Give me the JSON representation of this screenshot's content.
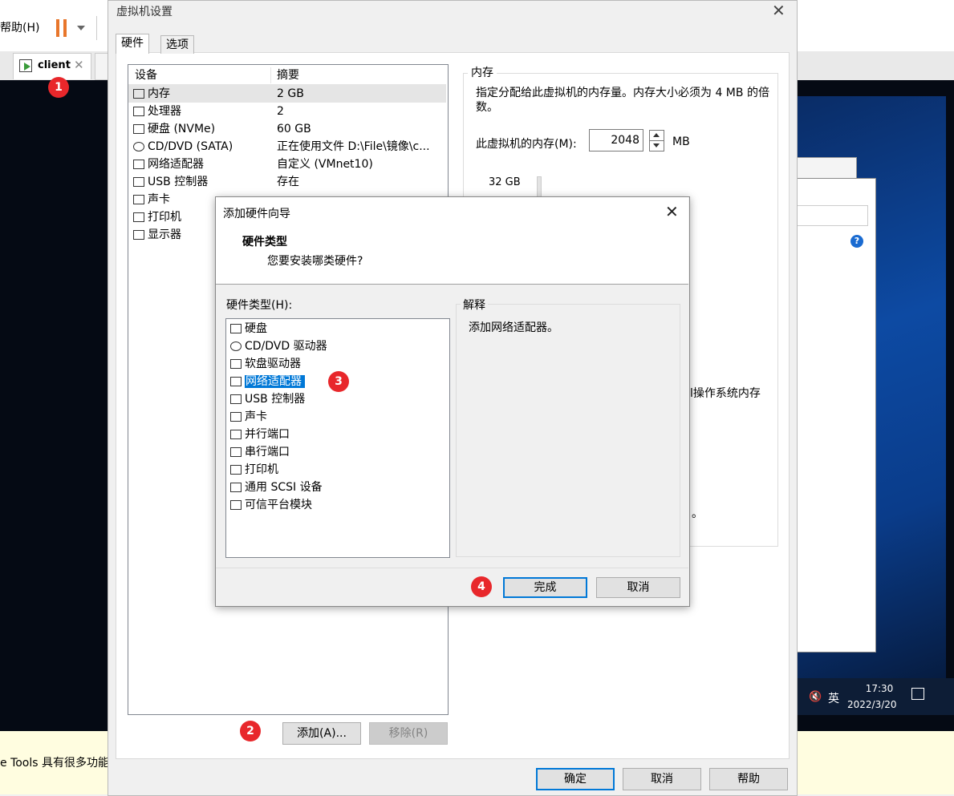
{
  "host": {
    "menu_help": "帮助(H)",
    "tab_label": "client",
    "tab_close": "✕",
    "bottom_text": "e Tools 具有很多功能"
  },
  "guest_tray": {
    "time": "17:30",
    "date": "2022/3/20",
    "lang": "英",
    "help_glyph": "?"
  },
  "settings": {
    "title": "虚拟机设置",
    "close": "✕",
    "tabs": [
      "硬件",
      "选项"
    ],
    "devices": {
      "header_device": "设备",
      "header_summary": "摘要",
      "rows": [
        {
          "name": "内存",
          "summary": "2 GB",
          "icon": "memory-icon"
        },
        {
          "name": "处理器",
          "summary": "2",
          "icon": "cpu-icon"
        },
        {
          "name": "硬盘 (NVMe)",
          "summary": "60 GB",
          "icon": "harddisk-icon"
        },
        {
          "name": "CD/DVD (SATA)",
          "summary": "正在使用文件 D:\\File\\镜像\\c...",
          "icon": "cd-icon"
        },
        {
          "name": "网络适配器",
          "summary": "自定义 (VMnet10)",
          "icon": "network-icon"
        },
        {
          "name": "USB 控制器",
          "summary": "存在",
          "icon": "usb-icon"
        },
        {
          "name": "声卡",
          "summary": "",
          "icon": "sound-icon"
        },
        {
          "name": "打印机",
          "summary": "",
          "icon": "printer-icon"
        },
        {
          "name": "显示器",
          "summary": "",
          "icon": "monitor-icon"
        }
      ]
    },
    "add_button": "添加(A)...",
    "remove_button": "移除(R)",
    "memory": {
      "group_label": "内存",
      "description": "指定分配给此虚拟机的内存量。内存大小必须为 4 MB 的倍数。",
      "field_label": "此虚拟机的内存(M):",
      "value": "2048",
      "unit": "MB",
      "tick_top": "32 GB",
      "partial_line": "l操作系统内存",
      "partial_period": "。"
    },
    "ok_button": "确定",
    "cancel_button": "取消",
    "help_button": "帮助"
  },
  "wizard": {
    "title": "添加硬件向导",
    "close": "✕",
    "heading": "硬件类型",
    "subheading": "您要安装哪类硬件?",
    "list_label": "硬件类型(H):",
    "items": [
      {
        "label": "硬盘",
        "icon": "harddisk-icon"
      },
      {
        "label": "CD/DVD 驱动器",
        "icon": "cd-icon"
      },
      {
        "label": "软盘驱动器",
        "icon": "floppy-icon"
      },
      {
        "label": "网络适配器",
        "icon": "network-icon"
      },
      {
        "label": "USB 控制器",
        "icon": "usb-icon"
      },
      {
        "label": "声卡",
        "icon": "sound-icon"
      },
      {
        "label": "并行端口",
        "icon": "parallel-port-icon"
      },
      {
        "label": "串行端口",
        "icon": "serial-port-icon"
      },
      {
        "label": "打印机",
        "icon": "printer-icon"
      },
      {
        "label": "通用 SCSI 设备",
        "icon": "scsi-icon"
      },
      {
        "label": "可信平台模块",
        "icon": "tpm-icon"
      }
    ],
    "selected_index": 3,
    "explain_label": "解释",
    "explain_text": "添加网络适配器。",
    "finish_button": "完成",
    "cancel_button": "取消"
  },
  "badges": [
    "1",
    "2",
    "3",
    "4"
  ],
  "colors": {
    "accent": "#0078d7",
    "badge": "#e8272b",
    "pause": "#e8762b"
  }
}
